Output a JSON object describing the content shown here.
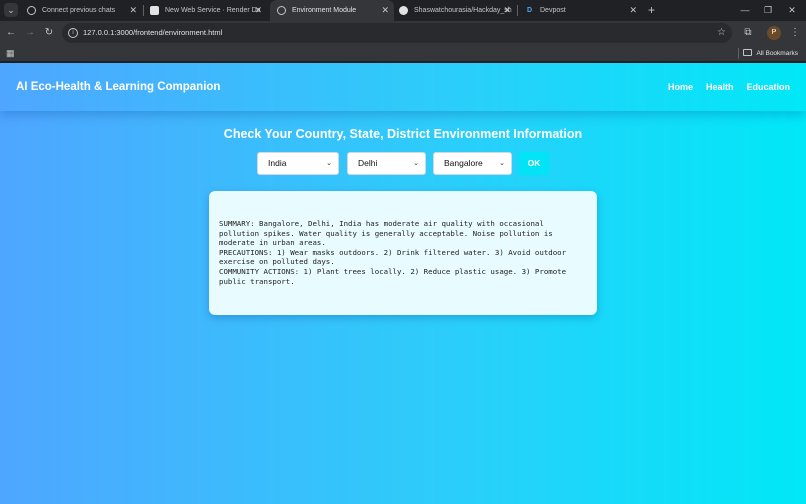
{
  "browser": {
    "tabs": [
      {
        "title": "Connect previous chats",
        "active": false
      },
      {
        "title": "New Web Service · Render Da",
        "active": false
      },
      {
        "title": "Environment Module",
        "active": true
      },
      {
        "title": "Shaswatchourasia/Hackday_sh",
        "active": false
      },
      {
        "title": "Devpost",
        "active": false
      }
    ],
    "url": "127.0.0.1:3000/frontend/environment.html",
    "all_bookmarks": "All Bookmarks"
  },
  "site": {
    "title": "AI Eco-Health & Learning Companion",
    "nav": [
      "Home",
      "Health",
      "Education"
    ]
  },
  "main": {
    "heading": "Check Your Country, State, District Environment Information",
    "country": "India",
    "state": "Delhi",
    "district": "Bangalore",
    "ok_label": "OK",
    "result_text": "SUMMARY: Bangalore, Delhi, India has moderate air quality with occasional\npollution spikes. Water quality is generally acceptable. Noise pollution is\nmoderate in urban areas.\nPRECAUTIONS: 1) Wear masks outdoors. 2) Drink filtered water. 3) Avoid outdoor\nexercise on polluted days.\nCOMMUNITY ACTIONS: 1) Plant trees locally. 2) Reduce plastic usage. 3) Promote\npublic transport."
  },
  "colors": {
    "page_gradient_start": "#4fa6ff",
    "page_gradient_end": "#00e8f8",
    "ok_button": "#00e4f6",
    "result_bg": "#e8fbfe"
  }
}
